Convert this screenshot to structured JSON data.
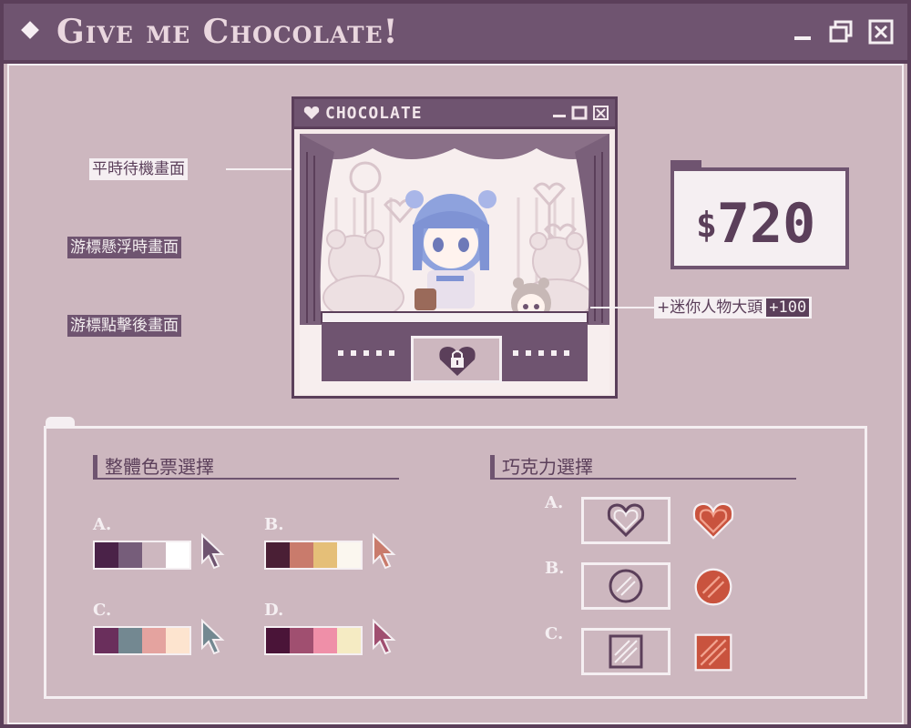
{
  "window": {
    "title": "Give me Chocolate!"
  },
  "mini_window": {
    "title": "CHOCOLATE"
  },
  "labels": {
    "idle": "平時待機畫面",
    "hover": "游標懸浮時畫面",
    "clicked": "游標點擊後畫面",
    "mini_avatar": "+迷你人物大頭",
    "mini_avatar_price": "+100"
  },
  "money": {
    "symbol": "$",
    "amount": "720"
  },
  "palette_section": {
    "title": "整體色票選擇",
    "options": [
      {
        "letter": "A.",
        "colors": [
          "#4a2248",
          "#765d7a",
          "#cdb7bf",
          "#ffffff"
        ],
        "cursor_color": "#6f5470"
      },
      {
        "letter": "B.",
        "colors": [
          "#4a1f35",
          "#c97b6c",
          "#e5bf78",
          "#fbf7ef"
        ],
        "cursor_color": "#c97b6c"
      },
      {
        "letter": "C.",
        "colors": [
          "#6a2f5c",
          "#738891",
          "#e4a39f",
          "#fde4cf"
        ],
        "cursor_color": "#738891"
      },
      {
        "letter": "D.",
        "colors": [
          "#4a1438",
          "#a04f70",
          "#ef8fa8",
          "#f5ebc3"
        ],
        "cursor_color": "#a04f70"
      }
    ]
  },
  "chocolate_section": {
    "title": "巧克力選擇",
    "options": [
      {
        "letter": "A.",
        "shape": "heart-icon"
      },
      {
        "letter": "B.",
        "shape": "circle-icon"
      },
      {
        "letter": "C.",
        "shape": "square-icon"
      }
    ]
  },
  "colors": {
    "frame": "#5b3f5a",
    "titlebar": "#6f5470",
    "background": "#cdb7bf",
    "chocolate": "#c9533e"
  }
}
